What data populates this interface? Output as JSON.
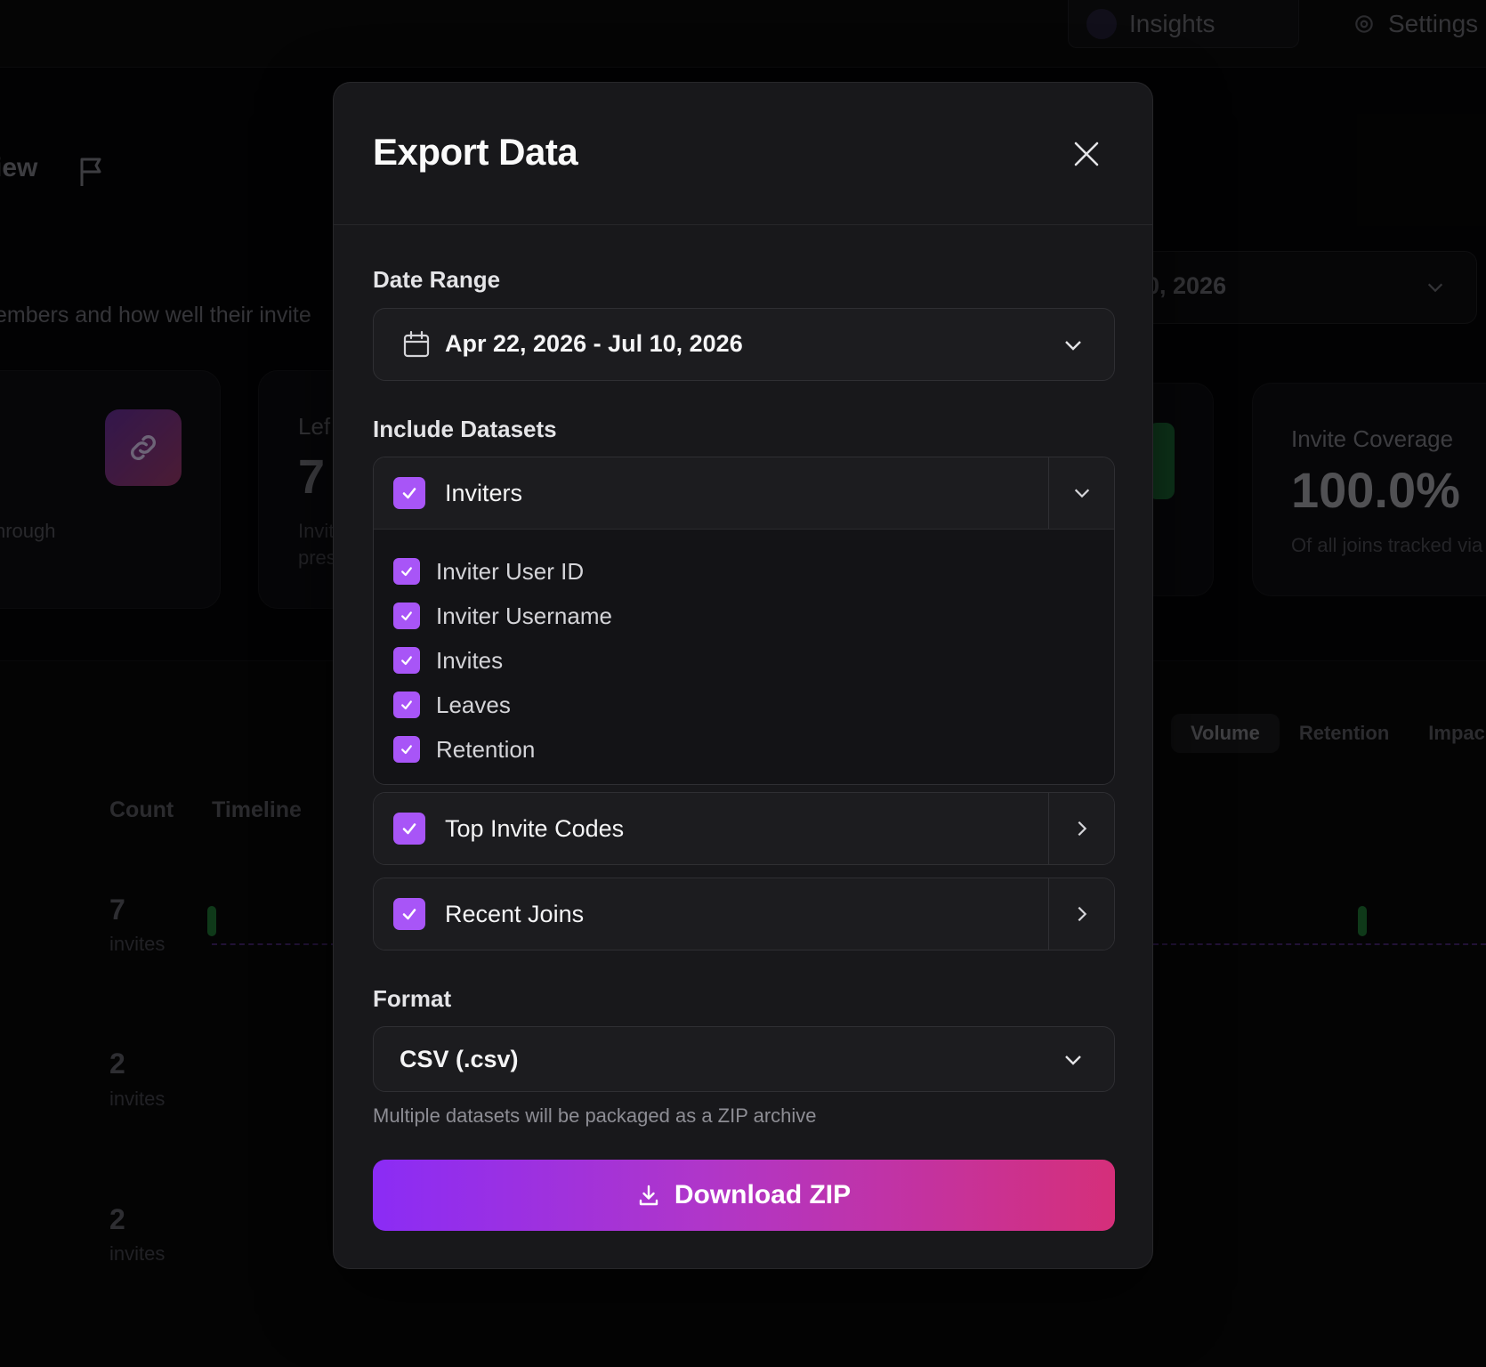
{
  "background": {
    "top_nav": {
      "active_tab": "Insights",
      "settings_tab": "Settings"
    },
    "view_title_fragment": "iew",
    "description_fragment": "embers and how well their invite",
    "date_select_fragment": "0, 2026",
    "cards": {
      "through_fragment": "hrough",
      "left_label": "Lef",
      "left_value": "7",
      "left_sub1": "Invit",
      "left_sub2": "pres",
      "coverage_label": "Invite Coverage",
      "coverage_value": "100.0%",
      "coverage_sub": "Of all joins tracked via"
    },
    "chart_tabs": [
      "Volume",
      "Retention",
      "Impac"
    ],
    "columns": {
      "count": "Count",
      "timeline": "Timeline"
    },
    "rows": [
      {
        "value": "7",
        "unit": "invites"
      },
      {
        "value": "2",
        "unit": "invites"
      },
      {
        "value": "2",
        "unit": "invites"
      }
    ]
  },
  "modal": {
    "title": "Export Data",
    "close_icon": "close-icon",
    "date_range": {
      "label": "Date Range",
      "value": "Apr 22, 2026 - Jul 10, 2026",
      "icon": "calendar-icon"
    },
    "datasets": {
      "label": "Include Datasets",
      "items": [
        {
          "name": "Inviters",
          "checked": true,
          "expanded": true,
          "fields": [
            {
              "name": "Inviter User ID",
              "checked": true
            },
            {
              "name": "Inviter Username",
              "checked": true
            },
            {
              "name": "Invites",
              "checked": true
            },
            {
              "name": "Leaves",
              "checked": true
            },
            {
              "name": "Retention",
              "checked": true
            }
          ]
        },
        {
          "name": "Top Invite Codes",
          "checked": true,
          "expanded": false
        },
        {
          "name": "Recent Joins",
          "checked": true,
          "expanded": false
        }
      ]
    },
    "format": {
      "label": "Format",
      "value": "CSV (.csv)",
      "hint": "Multiple datasets will be packaged as a ZIP archive"
    },
    "download_button": {
      "label": "Download ZIP",
      "icon": "download-icon"
    }
  },
  "colors": {
    "accent": "#a855f7",
    "button_gradient_start": "#8b2cf5",
    "button_gradient_end": "#d52f7a",
    "modal_bg": "#18181b"
  }
}
